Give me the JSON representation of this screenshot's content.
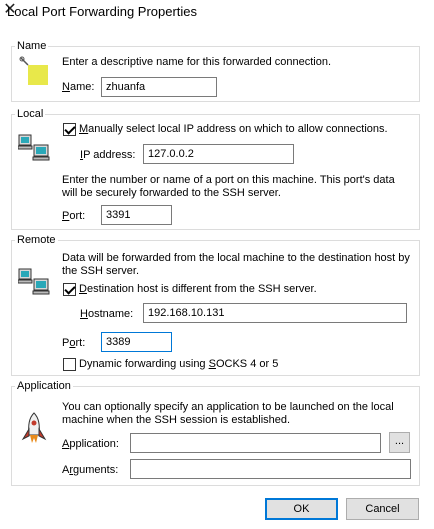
{
  "window": {
    "title": "Local Port Forwarding Properties"
  },
  "name_group": {
    "legend": "Name",
    "description": "Enter a descriptive name for this forwarded connection.",
    "name_label_u": "N",
    "name_label_rest": "ame:",
    "name_value": "zhuanfa"
  },
  "local_group": {
    "legend": "Local",
    "manual_checkbox_checked": true,
    "manual_label_u": "M",
    "manual_label_rest": "anually select local IP address on which to allow connections.",
    "ip_label_u": "I",
    "ip_label_rest": "P address:",
    "ip_value": "127.0.0.2",
    "port_description_1": "Enter the number or name of a port on this machine.  This port's data",
    "port_description_2": "will be securely forwarded to the SSH server.",
    "port_label_u": "P",
    "port_label_rest": "ort:",
    "port_value": "3391"
  },
  "remote_group": {
    "legend": "Remote",
    "description_1": "Data will be forwarded from the local machine to the destination host by",
    "description_2": "the SSH server.",
    "dest_checkbox_checked": true,
    "dest_label_u": "D",
    "dest_label_rest": "estination host is different from the SSH server.",
    "hostname_label_u": "H",
    "hostname_label_rest": "ostname:",
    "hostname_value": "192.168.10.131",
    "port_label_u": "o",
    "port_label_pre": "P",
    "port_label_rest": "rt:",
    "port_value": "3389",
    "dynamic_checkbox_checked": false,
    "dynamic_label_pre": "Dynamic forwarding using ",
    "dynamic_label_u": "S",
    "dynamic_label_rest": "OCKS 4 or 5"
  },
  "application_group": {
    "legend": "Application",
    "description_1": "You can optionally specify an application to be launched on the local",
    "description_2": "machine when the SSH session is established.",
    "application_label_u": "A",
    "application_label_rest": "pplication:",
    "application_value": "",
    "browse_label": "...",
    "arguments_label_pre": "A",
    "arguments_label_u": "r",
    "arguments_label_rest": "guments:",
    "arguments_value": ""
  },
  "buttons": {
    "ok": "OK",
    "cancel": "Cancel"
  },
  "colors": {
    "focus": "#0078d7",
    "icon_yellow": "#e8e84a",
    "icon_screen": "#2aa8b8"
  }
}
